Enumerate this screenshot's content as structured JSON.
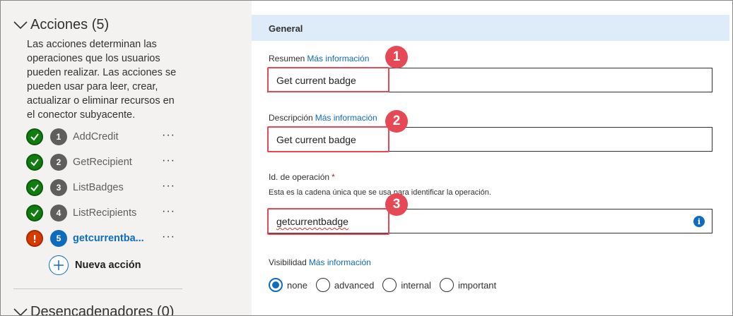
{
  "actions_section": {
    "title": "Acciones (5)",
    "description": "Las acciones determinan las operaciones que los usuarios pueden realizar. Las acciones se pueden usar para leer, crear, actualizar o eliminar recursos en el conector subyacente.",
    "items": [
      {
        "number": "1",
        "name": "AddCredit",
        "status": "ok",
        "menu": "···"
      },
      {
        "number": "2",
        "name": "GetRecipient",
        "status": "ok",
        "menu": "···"
      },
      {
        "number": "3",
        "name": "ListBadges",
        "status": "ok",
        "menu": "···"
      },
      {
        "number": "4",
        "name": "ListRecipients",
        "status": "ok",
        "menu": "···"
      },
      {
        "number": "5",
        "name": "getcurrentba...",
        "status": "error",
        "menu": "···"
      }
    ],
    "new_action_label": "Nueva acción"
  },
  "triggers_section": {
    "title": "Desencadenadores (0)"
  },
  "general": {
    "title": "General",
    "summary": {
      "label": "Resumen",
      "link": "Más información",
      "value": "Get current badge"
    },
    "description": {
      "label": "Descripción",
      "link": "Más información",
      "value": "Get current badge"
    },
    "operation_id": {
      "label": "Id. de operación",
      "required_mark": "*",
      "hint": "Esta es la cadena única que se usa para identificar la operación.",
      "value": "getcurrentbadge"
    },
    "visibility": {
      "label": "Visibilidad",
      "link": "Más información",
      "options": [
        "none",
        "advanced",
        "internal",
        "important"
      ],
      "selected": "none"
    }
  },
  "callouts": [
    "1",
    "2",
    "3"
  ],
  "colors": {
    "accent": "#0f6cbd",
    "success": "#107c10",
    "error": "#d83b01",
    "callout": "#e74856",
    "section_bar": "#deecf9"
  }
}
